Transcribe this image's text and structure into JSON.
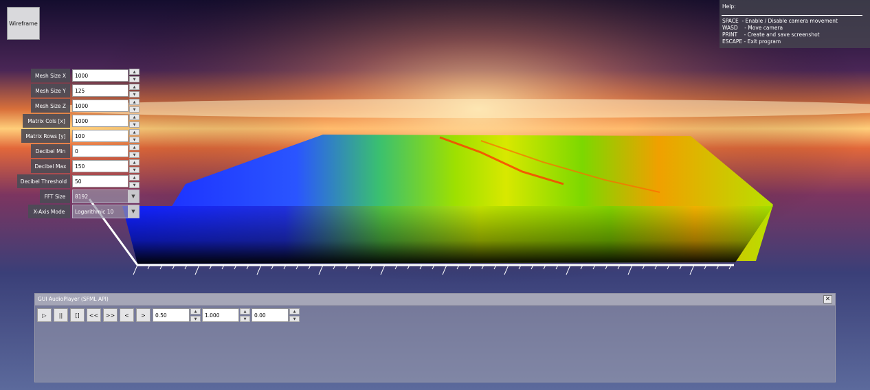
{
  "wireframe_button": "Wireframe",
  "help": {
    "title": "Help:",
    "lines": [
      "SPACE  - Enable / Disable camera movement",
      "WASD    - Move camera",
      "PRINT    - Create and save screenshot",
      "ESCAPE - Exit program"
    ]
  },
  "params": [
    {
      "label": "Mesh Size X",
      "value": "1000"
    },
    {
      "label": "Mesh Size Y",
      "value": "125"
    },
    {
      "label": "Mesh Size Z",
      "value": "1000"
    },
    {
      "label": "Matrix Cols [x]",
      "value": "1000"
    },
    {
      "label": "Matrix Rows [y]",
      "value": "100"
    },
    {
      "label": "Decibel Min",
      "value": "0"
    },
    {
      "label": "Decibel Max",
      "value": "150"
    },
    {
      "label": "Decibel Threshold",
      "value": "50"
    }
  ],
  "selects": [
    {
      "label": "FFT Size",
      "value": "8192"
    },
    {
      "label": "X-Axis Mode",
      "value": "Logarithmic 10"
    }
  ],
  "player": {
    "title": "GUI AudioPlayer (SFML API)",
    "buttons": [
      "▷",
      "||",
      "[]",
      "<<",
      ">>",
      "<",
      ">"
    ],
    "values": [
      "0.50",
      "1.000",
      "0.00"
    ]
  },
  "icons": {
    "close": "close-icon",
    "spin_up": "chevron-up-icon",
    "spin_down": "chevron-down-icon",
    "dropdown": "chevron-down-icon"
  },
  "colors": {
    "panel": "#4b4b55",
    "accent_low": "#1430ff",
    "accent_mid": "#6cd800",
    "accent_high": "#ff3a00"
  }
}
